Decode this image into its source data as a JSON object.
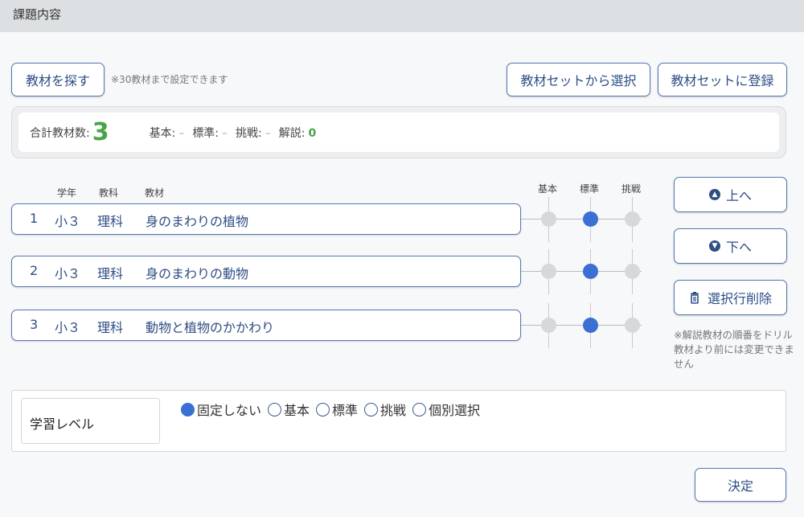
{
  "header": {
    "title": "課題内容"
  },
  "toolbar": {
    "search_label": "教材を探す",
    "note": "※30教材まで設定できます",
    "select_set_label": "教材セットから選択",
    "register_set_label": "教材セットに登録"
  },
  "summary": {
    "total_label": "合計教材数:",
    "total_value": "3",
    "levels": [
      {
        "label": "基本:",
        "value": "–"
      },
      {
        "label": "標準:",
        "value": "–"
      },
      {
        "label": "挑戦:",
        "value": "–"
      },
      {
        "label": "解説:",
        "value": "0"
      }
    ]
  },
  "table": {
    "headers": {
      "grade": "学年",
      "subject": "教科",
      "material": "教材"
    },
    "level_headers": [
      "基本",
      "標準",
      "挑戦"
    ],
    "rows": [
      {
        "num": "1",
        "grade": "小３",
        "subject": "理科",
        "title": "身のまわりの植物",
        "level": "標準"
      },
      {
        "num": "2",
        "grade": "小３",
        "subject": "理科",
        "title": "身のまわりの動物",
        "level": "標準"
      },
      {
        "num": "3",
        "grade": "小３",
        "subject": "理科",
        "title": "動物と植物のかかわり",
        "level": "標準"
      }
    ]
  },
  "side": {
    "up_label": "上へ",
    "down_label": "下へ",
    "delete_label": "選択行削除",
    "note": "※解説教材の順番をドリル教材より前には変更できません"
  },
  "learning_level": {
    "label": "学習レベル",
    "options": [
      "固定しない",
      "基本",
      "標準",
      "挑戦",
      "個別選択"
    ],
    "selected": "固定しない"
  },
  "footer": {
    "confirm_label": "決定"
  },
  "colors": {
    "accent": "#3a6fd4",
    "button_text": "#2e4e84",
    "count_green": "#4aa34a",
    "dot_inactive": "#d6d8da"
  },
  "icons": {
    "up": "arrow-up-circle-icon",
    "down": "arrow-down-circle-icon",
    "delete": "trash-icon"
  }
}
